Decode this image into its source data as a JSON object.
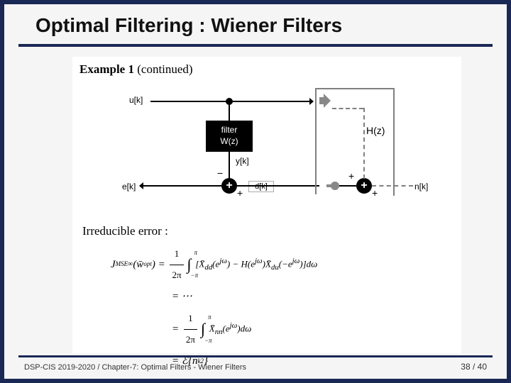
{
  "title": "Optimal Filtering : Wiener Filters",
  "example": {
    "heading_bold": "Example 1",
    "heading_rest": " (continued)"
  },
  "diagram": {
    "u_label": "u[k]",
    "filter_line1": "filter",
    "filter_line2": "W(z)",
    "y_label": "y[k]",
    "e_label": "e[k]",
    "d_label": "d[k]",
    "H_label": "H(z)",
    "n_label": "n[k]",
    "sum_minus": "−",
    "sum_plus_top": "+",
    "sum_plus_bottom": "+",
    "sum_sign": "+"
  },
  "text": {
    "irreducible": "Irreducible error :"
  },
  "equations": {
    "lhs": "J",
    "lhs_sub": "MSE",
    "lhs_arg": "(w̄",
    "lhs_arg_sub": "opt",
    "lhs_arg_close": ")",
    "lhs_sup": "∞",
    "frac_num": "1",
    "frac_den": "2π",
    "int_lower": "−π",
    "int_upper": "π",
    "line1_integrand": "[X̄_dd(e^{jω}) − H(e^{jω})X̄_du(−e^{jω})]dω",
    "line2": "= ⋯",
    "line3_integrand": "X̄_nn(e^{jω})dω",
    "line4": "= ℰ{n_k²}"
  },
  "footer": {
    "left": "DSP-CIS 2019-2020 /  Chapter-7: Optimal Filters - Wiener Filters",
    "page_current": "38",
    "page_sep": " / ",
    "page_total": "40"
  }
}
